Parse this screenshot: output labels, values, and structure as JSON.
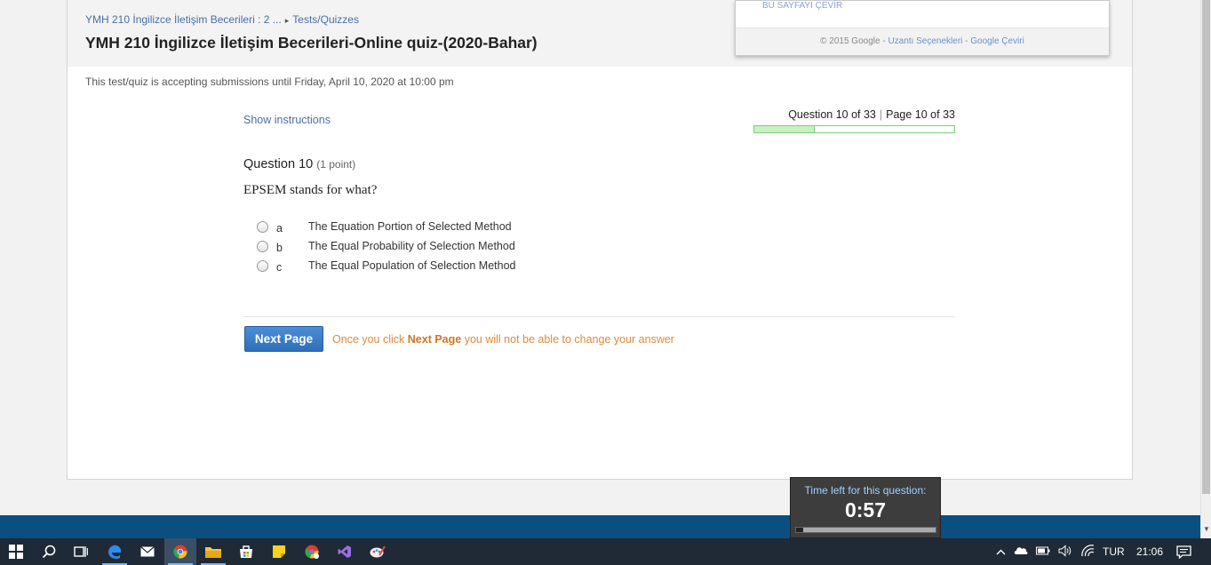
{
  "breadcrumb": {
    "course": "YMH 210 İngilizce İletişim Becerileri : 2 ...",
    "separator": "▸",
    "section": "Tests/Quizzes"
  },
  "page_title": "YMH 210 İngilizce İletişim Becerileri-Online quiz-(2020-Bahar)",
  "availability": "This test/quiz is accepting submissions until Friday, April 10, 2020 at 10:00 pm",
  "translate_panel": {
    "translate_link": "BU SAYFAYI ÇEVİR",
    "copyright": "© 2015 Google -",
    "ext_options": "Uzantı Seçenekleri",
    "dash": "-",
    "google_translate": "Google Çeviri"
  },
  "quiz": {
    "show_instructions": "Show instructions",
    "question_count": "Question 10 of 33",
    "count_separator": "|",
    "page_count": "Page 10 of 33",
    "progress_fraction": 0.303,
    "question_label": "Question 10",
    "points": "(1 point)",
    "question_text": "EPSEM stands for what?",
    "options": [
      {
        "letter": "a",
        "text": "The Equation Portion of Selected Method"
      },
      {
        "letter": "b",
        "text": "The Equal Probability of Selection Method"
      },
      {
        "letter": "c",
        "text": "The Equal Population of Selection Method"
      }
    ],
    "next_button": "Next Page",
    "warning_prefix": "Once you click",
    "warning_emphasis": "Next Page",
    "warning_suffix": "you will not be able to change your answer"
  },
  "timer": {
    "label": "Time left for this question:",
    "value": "0:57",
    "remaining_fraction": 0.05
  },
  "taskbar": {
    "language": "TUR",
    "time": "21:06",
    "icons": [
      "windows-start-icon",
      "search-icon",
      "task-view-icon",
      "edge-icon",
      "mail-icon",
      "chrome-icon",
      "file-explorer-icon",
      "store-icon",
      "sticky-notes-icon",
      "chrome-alt-icon",
      "visual-studio-icon",
      "paint-icon"
    ]
  },
  "colors": {
    "link": "#4a6fa5",
    "accent_button": "#2f6fb8",
    "warning": "#e08a3c",
    "progress": "#c9f0c0",
    "footer_band": "#0a4f7f",
    "taskbar": "#1f2a36"
  }
}
